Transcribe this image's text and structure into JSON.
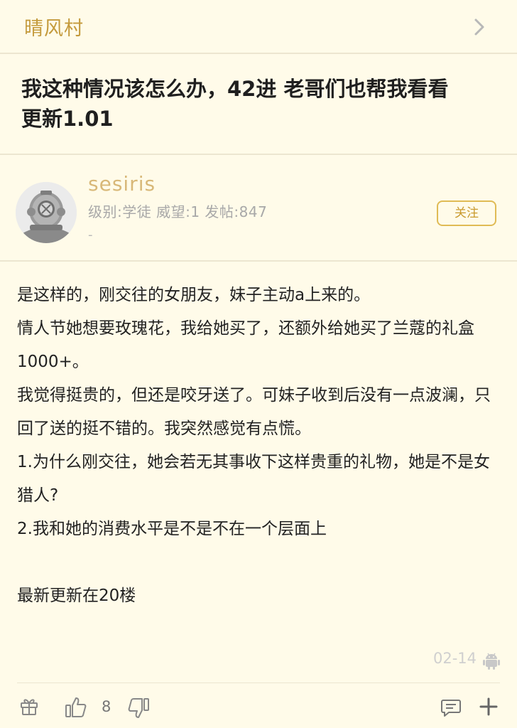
{
  "header": {
    "forum_name": "晴风村"
  },
  "post": {
    "title_line1": "我这种情况该怎么办，42进 老哥们也帮我看看",
    "title_line2": "更新1.01"
  },
  "author": {
    "username": "sesiris",
    "meta": "级别:学徒 威望:1 发帖:847",
    "signature": "-",
    "follow_label": "关注"
  },
  "content": {
    "paragraphs": [
      "是这样的，刚交往的女朋友，妹子主动a上来的。",
      "情人节她想要玫瑰花，我给她买了，还额外给她买了兰蔻的礼盒1000+。",
      "我觉得挺贵的，但还是咬牙送了。可妹子收到后没有一点波澜，只回了送的挺不错的。我突然感觉有点慌。",
      "1.为什么刚交往，她会若无其事收下这样贵重的礼物，她是不是女猎人?",
      "2.我和她的消费水平是不是不在一个层面上",
      "最新更新在20楼"
    ],
    "date": "02-14"
  },
  "toolbar": {
    "like_count": "8"
  },
  "colors": {
    "background": "#fffbe9",
    "accent": "#c49a3c",
    "divider": "#ece6d0"
  },
  "icons": [
    "chevron-right-icon",
    "avatar-diving-helmet",
    "android-icon",
    "gift-icon",
    "thumbs-up-icon",
    "thumbs-down-icon",
    "comment-icon",
    "plus-icon"
  ]
}
